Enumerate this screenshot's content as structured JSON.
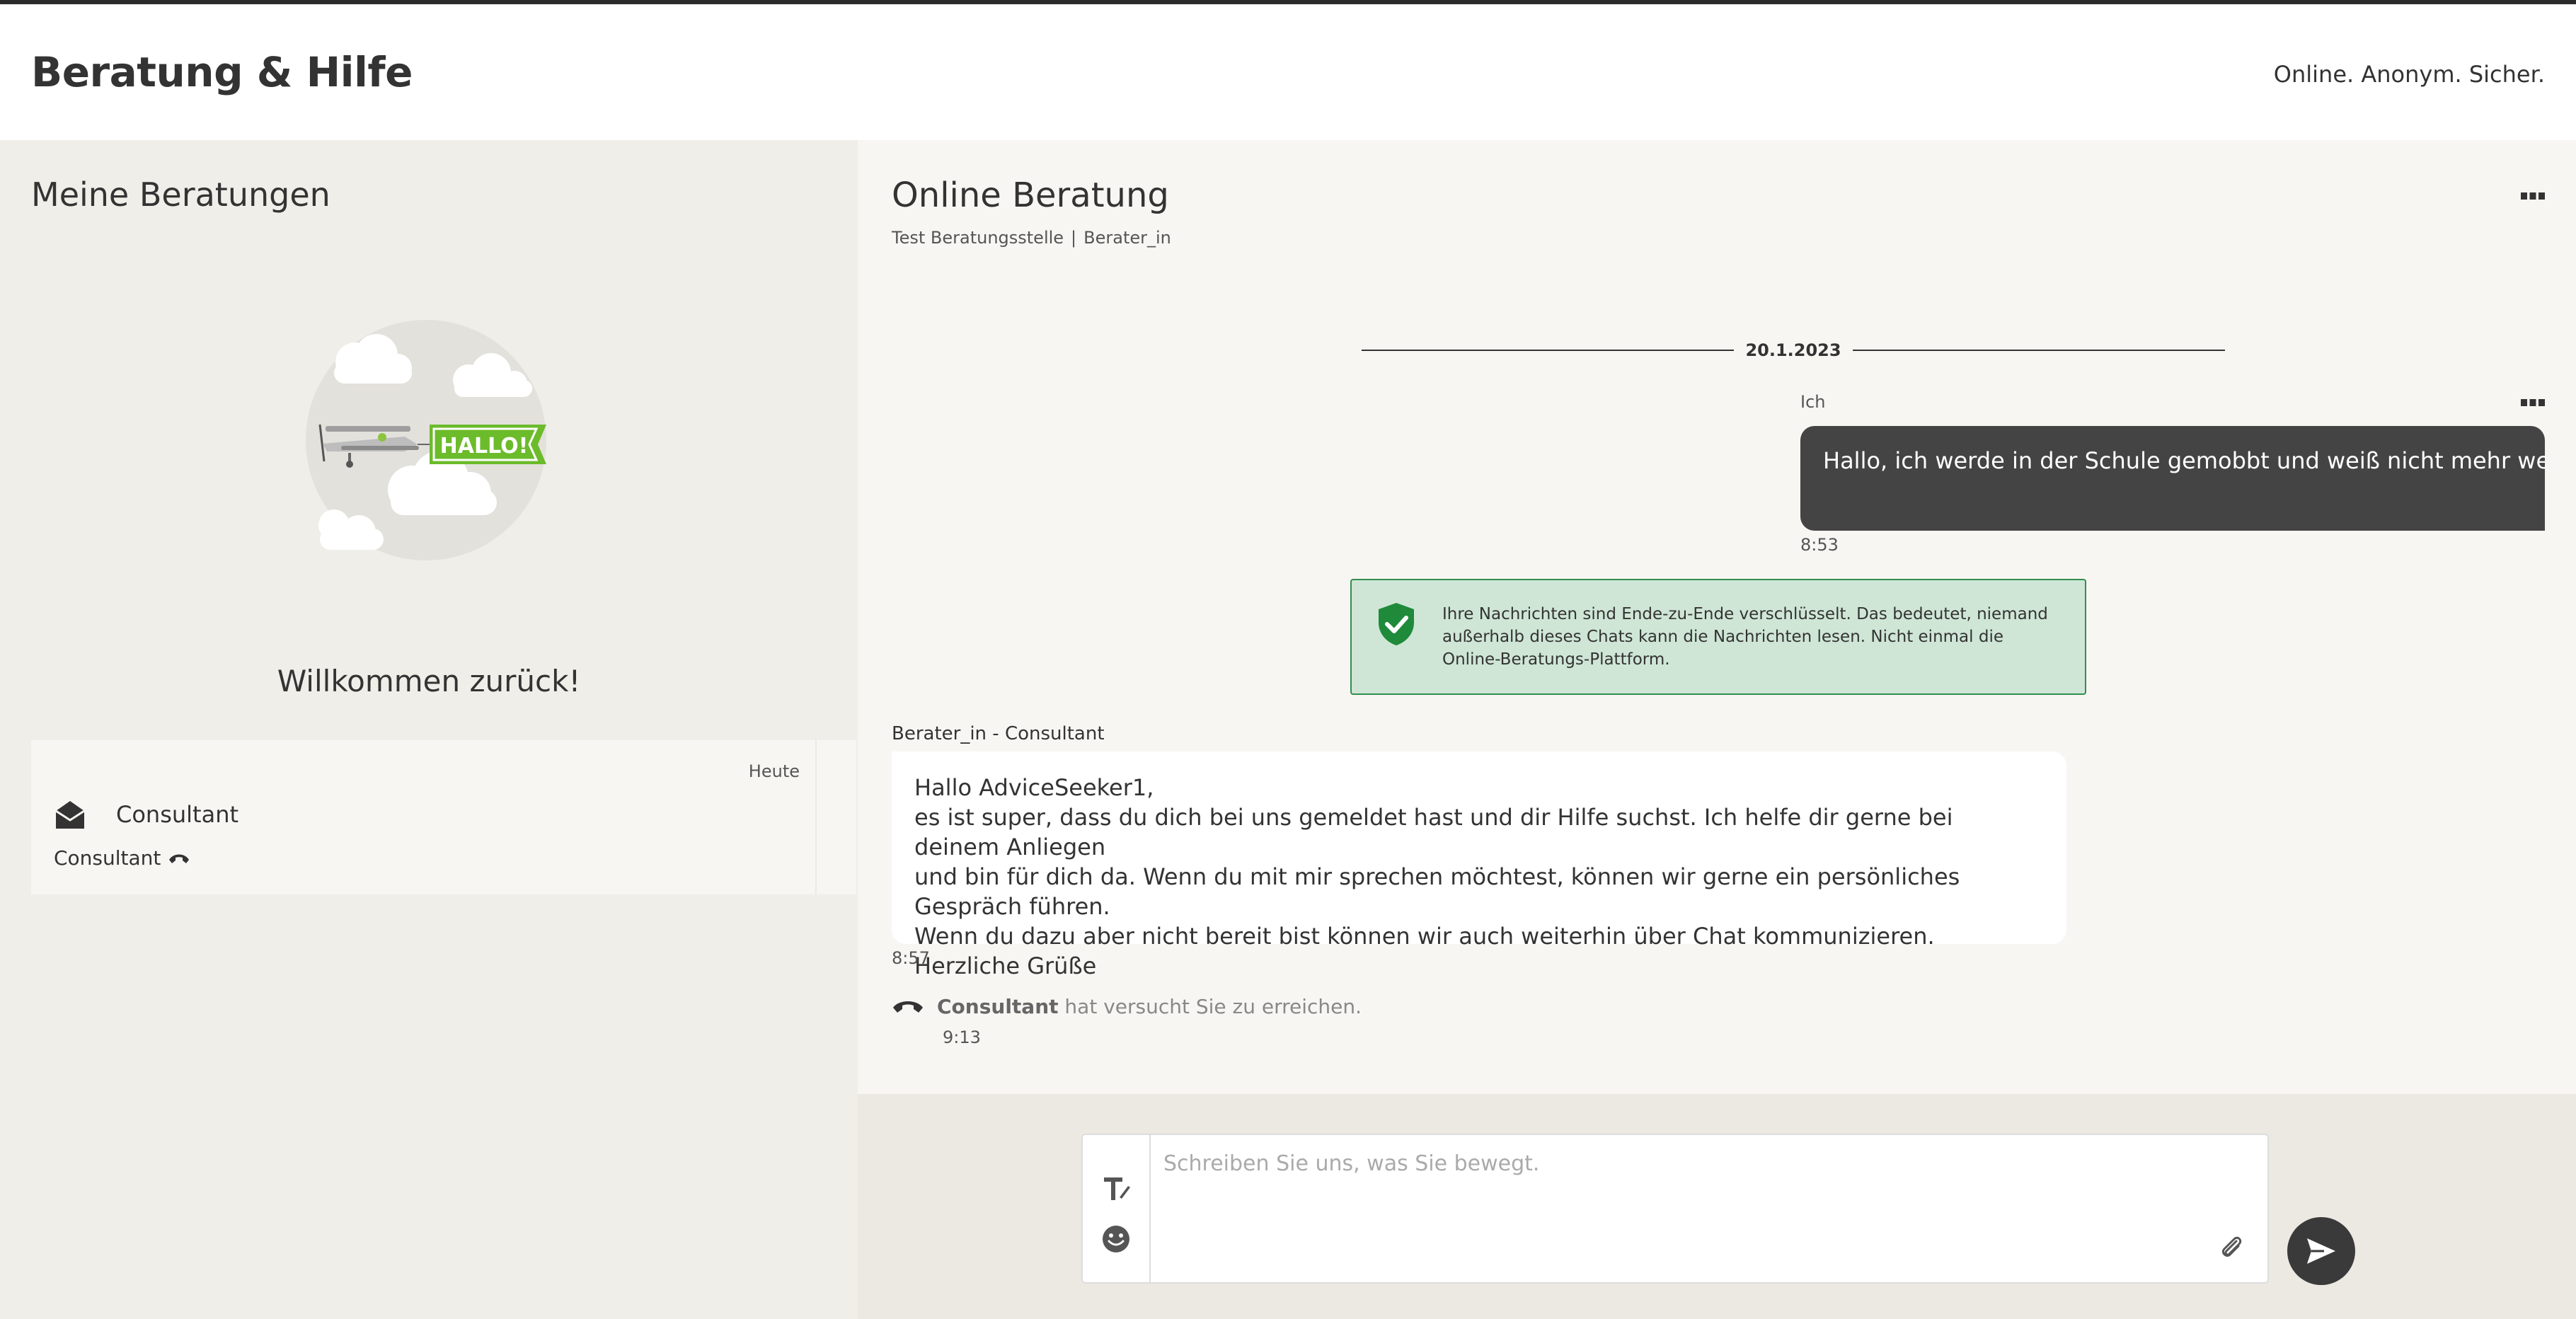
{
  "header": {
    "brand": "Beratung & Hilfe",
    "claim": "Online. Anonym. Sicher."
  },
  "sidebar": {
    "title": "Meine Beratungen",
    "illustration_banner": "HALLO!",
    "welcome": "Willkommen zurück!",
    "session": {
      "date": "Heute",
      "name": "Consultant",
      "subtitle": "Consultant",
      "icon": "envelope-open-icon",
      "sub_icon": "phone-hangup-icon"
    }
  },
  "chat": {
    "title": "Online Beratung",
    "agency": "Test Beratungsstelle",
    "separator": "|",
    "role": "Berater_in",
    "date": "20.1.2023",
    "messages": {
      "me": {
        "sender": "Ich",
        "text": "Hallo, ich werde in der Schule gemobbt und weiß nicht mehr weiter...",
        "time": "8:53"
      },
      "e2e_notice": "Ihre Nachrichten sind Ende-zu-Ende verschlüsselt. Das bedeutet, niemand außerhalb dieses Chats kann die Nachrichten lesen. Nicht einmal die Online-Beratungs-Plattform.",
      "consultant": {
        "sender": "Berater_in - Consultant",
        "lines": [
          "Hallo AdviceSeeker1,",
          "es ist super, dass du dich bei uns gemeldet hast und dir Hilfe suchst. Ich helfe dir gerne bei deinem Anliegen",
          "und bin für dich da. Wenn du mit mir sprechen möchtest, können wir gerne ein persönliches Gespräch führen.",
          "Wenn du dazu aber nicht bereit bist können wir auch weiterhin über Chat kommunizieren.",
          "Herzliche Grüße"
        ],
        "time": "8:57"
      },
      "call_event": {
        "name": "Consultant",
        "text": "hat versucht Sie zu erreichen.",
        "time": "9:13"
      }
    }
  },
  "composer": {
    "placeholder": "Schreiben Sie uns, was Sie bewegt."
  },
  "colors": {
    "sidebar_bg": "#f0eee9",
    "chat_bg": "#f8f6f2",
    "own_bubble": "#444444",
    "e2e_bg": "#cfe6d6",
    "e2e_border": "#2f8f4e",
    "shield": "#1f8a3a",
    "banner_green": "#6cbb2b"
  }
}
